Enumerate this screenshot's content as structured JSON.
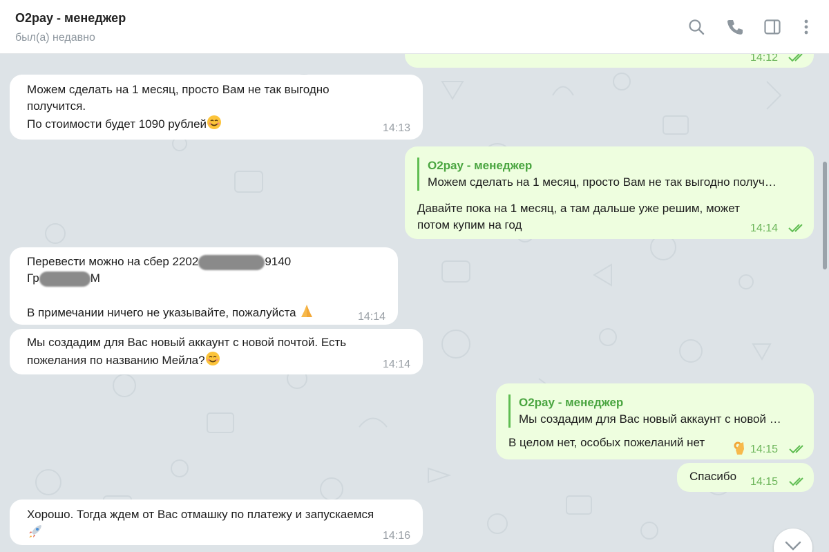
{
  "header": {
    "title": "O2pay - менеджер",
    "status": "был(а) недавно",
    "icons": [
      "search-icon",
      "phone-icon",
      "sidebar-toggle-icon",
      "more-vertical-icon"
    ]
  },
  "messages": [
    {
      "side": "out",
      "time": "14:12"
    },
    {
      "side": "in",
      "lines": [
        "Можем сделать на 1 месяц, просто Вам не так выгодно",
        "получится.",
        "По стоимости будет 1090 рублей"
      ],
      "time": "14:13"
    },
    {
      "side": "out",
      "reply_name": "O2pay - менеджер",
      "reply_text": "Можем сделать на 1 месяц, просто Вам не так выгодно получ…",
      "lines": [
        "Давайте пока на 1 месяц, а там дальше уже решим, может",
        "потом купим на год"
      ],
      "time": "14:14"
    },
    {
      "side": "in",
      "line1_prefix": "Перевести можно на сбер 2202",
      "line1_suffix": "9140",
      "line2_prefix": "Гр",
      "line2_suffix": "М",
      "line3": "В примечании ничего не указывайте, пожалуйста",
      "time": "14:14"
    },
    {
      "side": "in",
      "lines": [
        "Мы создадим для Вас новый аккаунт с новой почтой. Есть",
        "пожелания по названию Мейла?"
      ],
      "time": "14:14"
    },
    {
      "side": "out",
      "reply_name": "O2pay - менеджер",
      "reply_text": "Мы создадим для Вас новый аккаунт с новой …",
      "lines": [
        "В целом нет, особых пожеланий нет"
      ],
      "time": "14:15"
    },
    {
      "side": "out",
      "lines": [
        "Спасибо"
      ],
      "time": "14:15"
    },
    {
      "side": "in",
      "lines": [
        "Хорошо. Тогда ждем от Вас отмашку по платежу и запускаемся"
      ],
      "time": "14:16"
    }
  ],
  "colors": {
    "incoming": "#ffffff",
    "outgoing": "#eefedf",
    "accent": "#4aa540",
    "background": "#dde3e7"
  }
}
